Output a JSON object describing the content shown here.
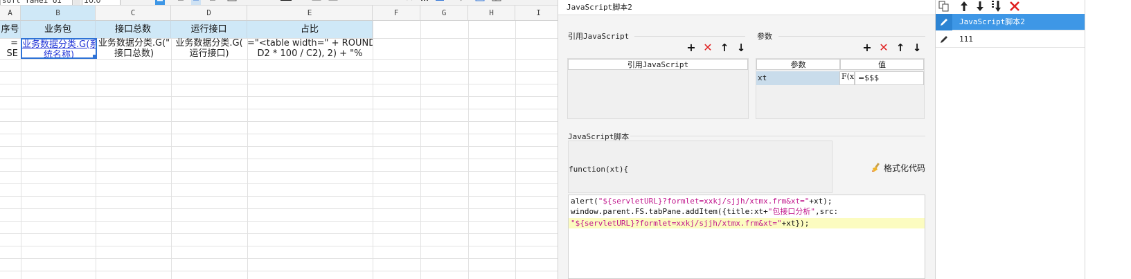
{
  "toolbar": {
    "font_name": "soft YaHei UI",
    "font_size": "10.0"
  },
  "sheet": {
    "columns": [
      "A",
      "B",
      "C",
      "D",
      "E",
      "F",
      "G",
      "H",
      "I"
    ],
    "headers": [
      "序号",
      "业务包",
      "接口总数",
      "运行接口",
      "占比"
    ],
    "row1": {
      "a": [
        "=",
        "SE"
      ],
      "b": [
        "业务数据分类.G(系",
        "统名称)"
      ],
      "c": [
        "业务数据分类.G(\"",
        "接口总数)"
      ],
      "d": [
        "业务数据分类.G(",
        "运行接口)"
      ],
      "e": [
        "=\"<table width=\" + ROUND((",
        "D2 * 100 / C2), 2) + \"%"
      ]
    }
  },
  "editor": {
    "title": "JavaScript脚本2",
    "ref_section_label": "引用JavaScript",
    "ref_table_header": "引用JavaScript",
    "param_section_label": "参数",
    "param_headers": [
      "参数",
      "值"
    ],
    "param_row": {
      "name": "xt",
      "fx": "F(x)",
      "value": "=$$$"
    },
    "script_section_label": "JavaScript脚本",
    "fn_signature": "function(xt){",
    "format_button": "格式化代码",
    "code": {
      "line1": {
        "a": "alert(",
        "b": "\"${servletURL}?formlet=xxkj/sjjh/xtmx.frm&xt=\"",
        "c": "+xt);"
      },
      "line2": {
        "a": "window.parent.FS.tabPane.addItem({title:xt+",
        "b": "\"包接口分析\"",
        "c": ",src:"
      },
      "line3": {
        "a": "\"${servletURL}?formlet=xxkj/sjjh/xtmx.frm&xt=\"",
        "b": "+xt});"
      }
    }
  },
  "right_panel": {
    "items": [
      {
        "label": "JavaScript脚本2",
        "selected": true
      },
      {
        "label": "111",
        "selected": false
      }
    ]
  },
  "colors": {
    "accent": "#3e97e6",
    "delete": "#e02020",
    "header_fill": "#cfe8f7",
    "string": "#c0158c",
    "highlight_line": "#fcfcc0"
  }
}
